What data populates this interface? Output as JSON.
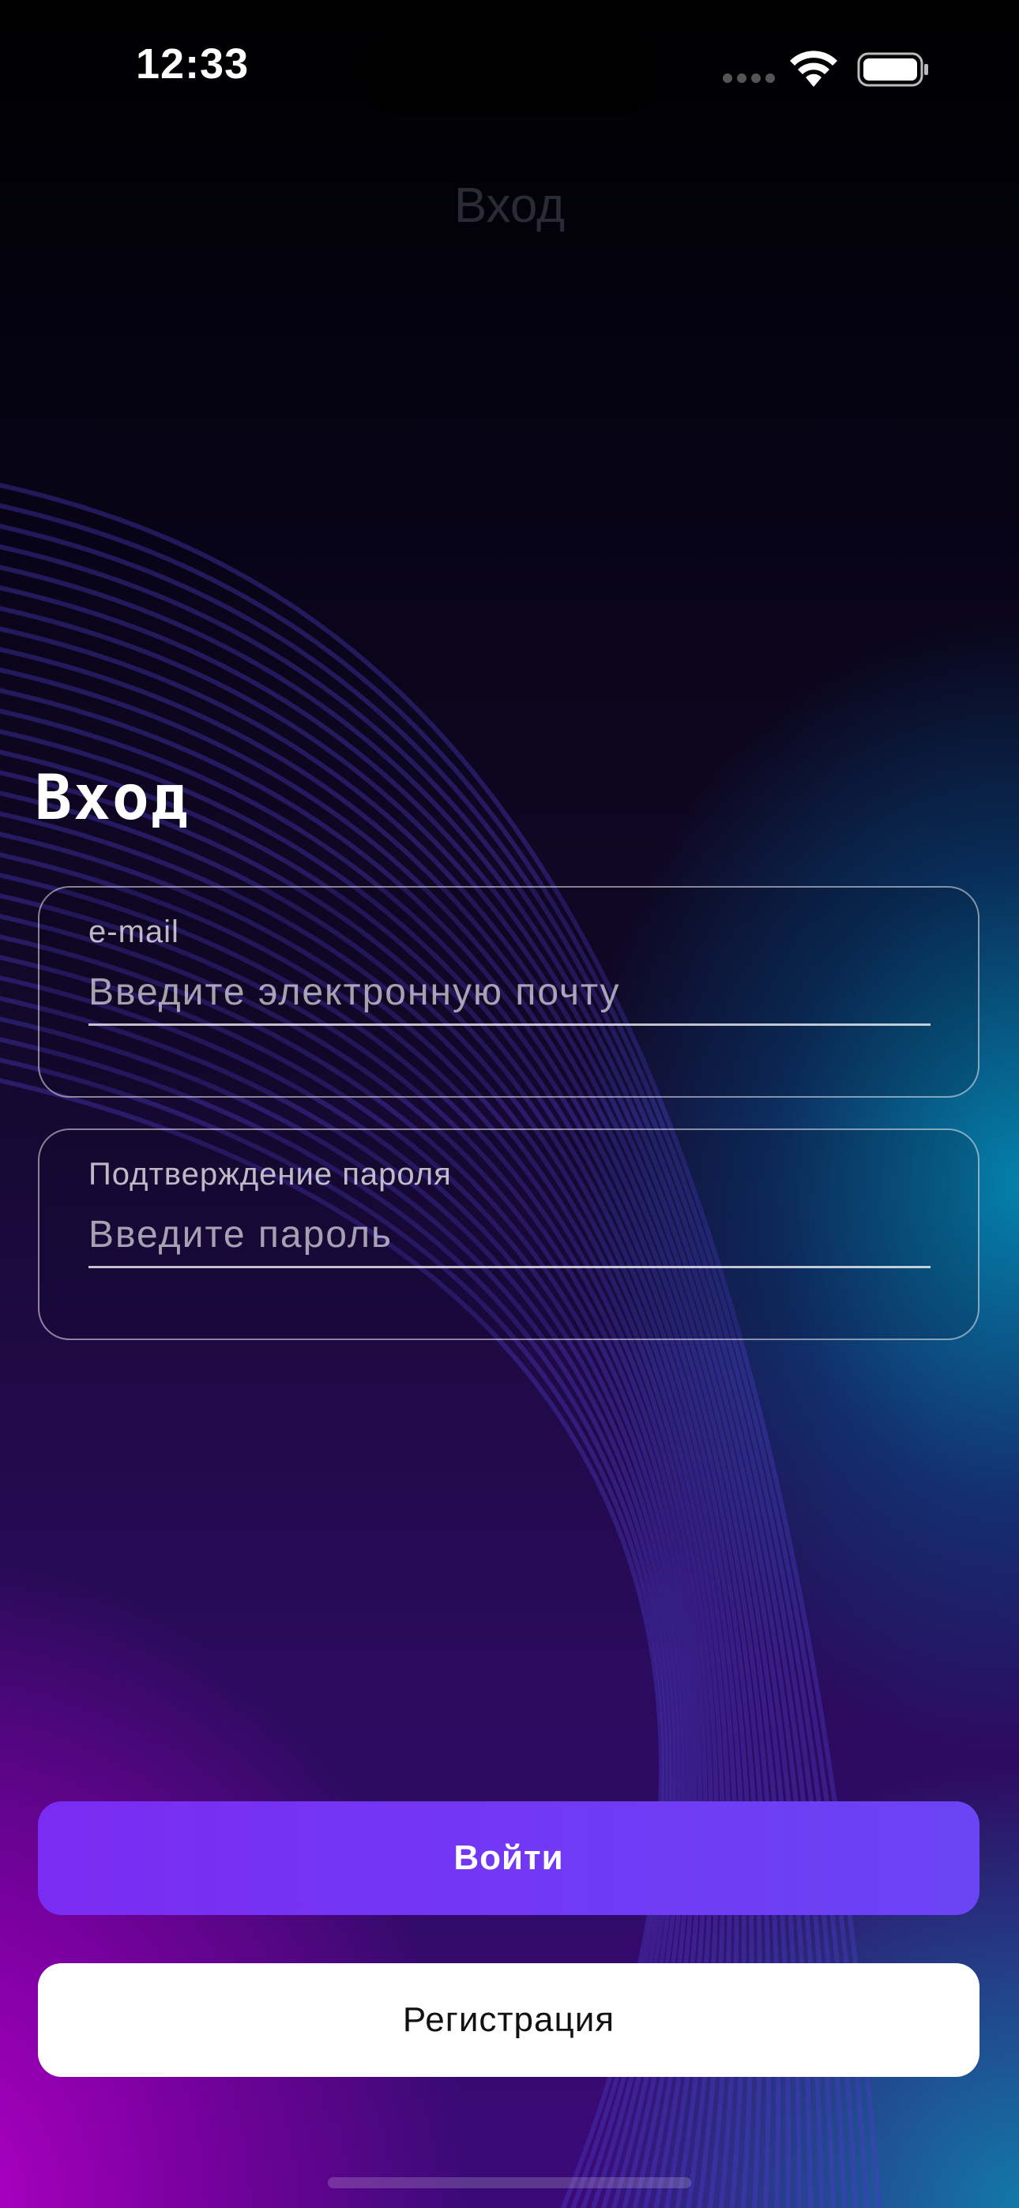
{
  "status_bar": {
    "time": "12:33",
    "icons": [
      "signal-icon",
      "wifi-icon",
      "battery-icon"
    ]
  },
  "nav": {
    "title": "Вход"
  },
  "heading": "Вход",
  "form": {
    "email": {
      "label": "e-mail",
      "placeholder": "Введите электронную почту",
      "value": ""
    },
    "password": {
      "label": "Подтверждение пароля",
      "placeholder": "Введите пароль",
      "value": ""
    }
  },
  "buttons": {
    "login_label": "Войти",
    "register_label": "Регистрация"
  },
  "colors": {
    "primary": "#7a2cf2",
    "secondary": "#ffffff",
    "background": "#000000"
  }
}
